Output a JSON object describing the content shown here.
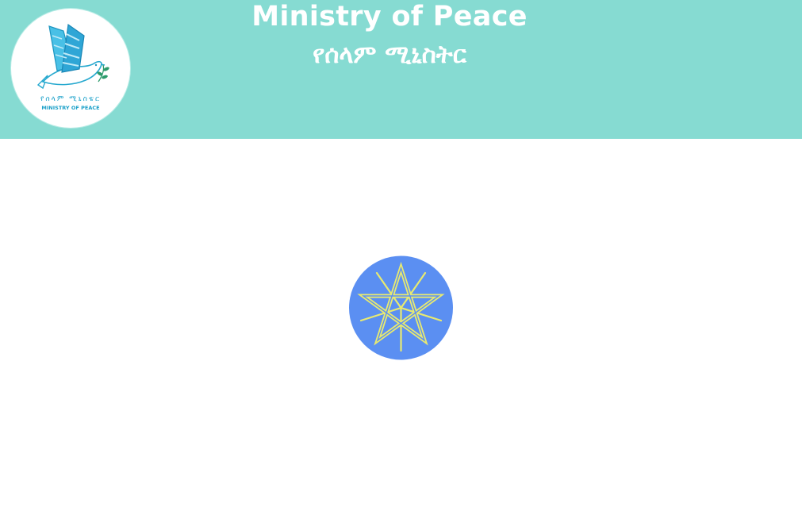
{
  "header": {
    "background": "#86dbd2",
    "title_en": "Ministry of Peace",
    "title_am": "የሰላም ሚኒስትር"
  },
  "logo": {
    "icon": "dove-logo-icon",
    "text_am": "የሰላም ሚኒስቴር",
    "text_en": "MINISTRY OF PEACE"
  },
  "emblem": {
    "icon": "ethiopian-emblem-star-icon",
    "disc_color": "#5b8ff2",
    "star_color": "#e8ea70"
  }
}
